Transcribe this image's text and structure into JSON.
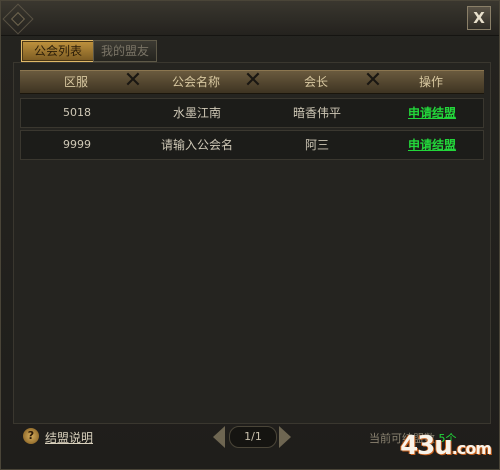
{
  "window": {
    "close_label": "X"
  },
  "tabs": [
    {
      "label": "公会列表"
    },
    {
      "label": "我的盟友"
    }
  ],
  "table": {
    "headers": [
      "区服",
      "公会名称",
      "会长",
      "操作"
    ],
    "rows": [
      {
        "zone": "5018",
        "guild": "水墨江南",
        "leader": "暗香伟平",
        "action": "申请结盟"
      },
      {
        "zone": "9999",
        "guild": "请输入公会名",
        "leader": "阿三",
        "action": "申请结盟"
      }
    ]
  },
  "footer": {
    "help_label": "结盟说明",
    "page": "1/1",
    "count_label": "当前可结盟数",
    "count_value": "5个"
  },
  "watermark": {
    "main": "43u",
    "suffix": ".com"
  },
  "colors": {
    "accent_green": "#22d63a",
    "tab_gold": "#c0933e",
    "header_bronze": "#6a5a3e"
  }
}
